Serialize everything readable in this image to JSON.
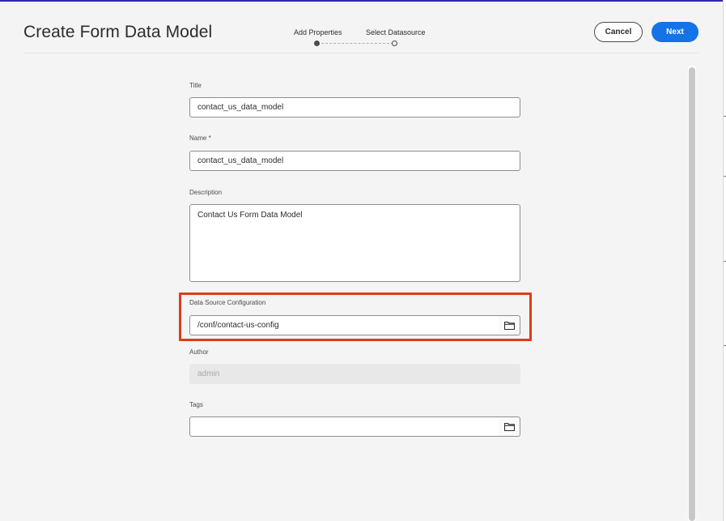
{
  "header": {
    "title": "Create Form Data Model",
    "cancel_label": "Cancel",
    "next_label": "Next"
  },
  "wizard": {
    "steps": [
      {
        "label": "Add Properties",
        "state": "current"
      },
      {
        "label": "Select Datasource",
        "state": "pending"
      }
    ]
  },
  "form": {
    "title": {
      "label": "Title",
      "value": "contact_us_data_model"
    },
    "name": {
      "label": "Name *",
      "value": "contact_us_data_model"
    },
    "description": {
      "label": "Description",
      "value": "Contact Us Form Data Model"
    },
    "data_source": {
      "label": "Data Source Configuration",
      "value": "/conf/contact-us-config"
    },
    "author": {
      "label": "Author",
      "value": "admin"
    },
    "tags": {
      "label": "Tags",
      "value": ""
    }
  },
  "icons": {
    "browse": "folder-icon"
  },
  "colors": {
    "primary": "#1473e6",
    "highlight": "#e03b18",
    "top_bar": "#2d2aa8"
  }
}
